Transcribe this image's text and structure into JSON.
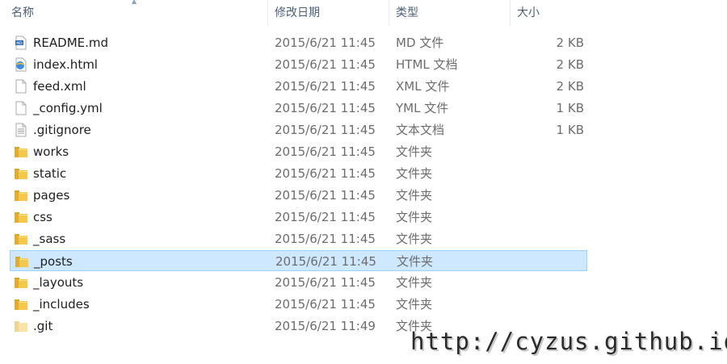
{
  "columns": {
    "name": "名称",
    "date": "修改日期",
    "type": "类型",
    "size": "大小"
  },
  "files": [
    {
      "name": "README.md",
      "date": "2015/6/21 11:45",
      "type": "MD 文件",
      "size": "2 KB",
      "icon": "markdown-file-icon"
    },
    {
      "name": "index.html",
      "date": "2015/6/21 11:45",
      "type": "HTML 文档",
      "size": "2 KB",
      "icon": "browser-file-icon"
    },
    {
      "name": "feed.xml",
      "date": "2015/6/21 11:45",
      "type": "XML 文件",
      "size": "2 KB",
      "icon": "file-icon"
    },
    {
      "name": "_config.yml",
      "date": "2015/6/21 11:45",
      "type": "YML 文件",
      "size": "1 KB",
      "icon": "file-icon"
    },
    {
      "name": ".gitignore",
      "date": "2015/6/21 11:45",
      "type": "文本文档",
      "size": "1 KB",
      "icon": "text-file-icon"
    },
    {
      "name": "works",
      "date": "2015/6/21 11:45",
      "type": "文件夹",
      "size": "",
      "icon": "folder-icon"
    },
    {
      "name": "static",
      "date": "2015/6/21 11:45",
      "type": "文件夹",
      "size": "",
      "icon": "folder-icon"
    },
    {
      "name": "pages",
      "date": "2015/6/21 11:45",
      "type": "文件夹",
      "size": "",
      "icon": "folder-icon"
    },
    {
      "name": "css",
      "date": "2015/6/21 11:45",
      "type": "文件夹",
      "size": "",
      "icon": "folder-icon"
    },
    {
      "name": "_sass",
      "date": "2015/6/21 11:45",
      "type": "文件夹",
      "size": "",
      "icon": "folder-icon"
    },
    {
      "name": "_posts",
      "date": "2015/6/21 11:45",
      "type": "文件夹",
      "size": "",
      "icon": "folder-icon",
      "selected": true
    },
    {
      "name": "_layouts",
      "date": "2015/6/21 11:45",
      "type": "文件夹",
      "size": "",
      "icon": "folder-icon"
    },
    {
      "name": "_includes",
      "date": "2015/6/21 11:45",
      "type": "文件夹",
      "size": "",
      "icon": "folder-icon"
    },
    {
      "name": ".git",
      "date": "2015/6/21 11:49",
      "type": "文件夹",
      "size": "",
      "icon": "folder-hidden-icon"
    }
  ],
  "watermark": "http://cyzus.github.io/",
  "colors": {
    "selection_bg": "#cde8ff",
    "selection_border": "#99d1ff",
    "header_text": "#4c607a",
    "folder": "#e8b73a"
  }
}
